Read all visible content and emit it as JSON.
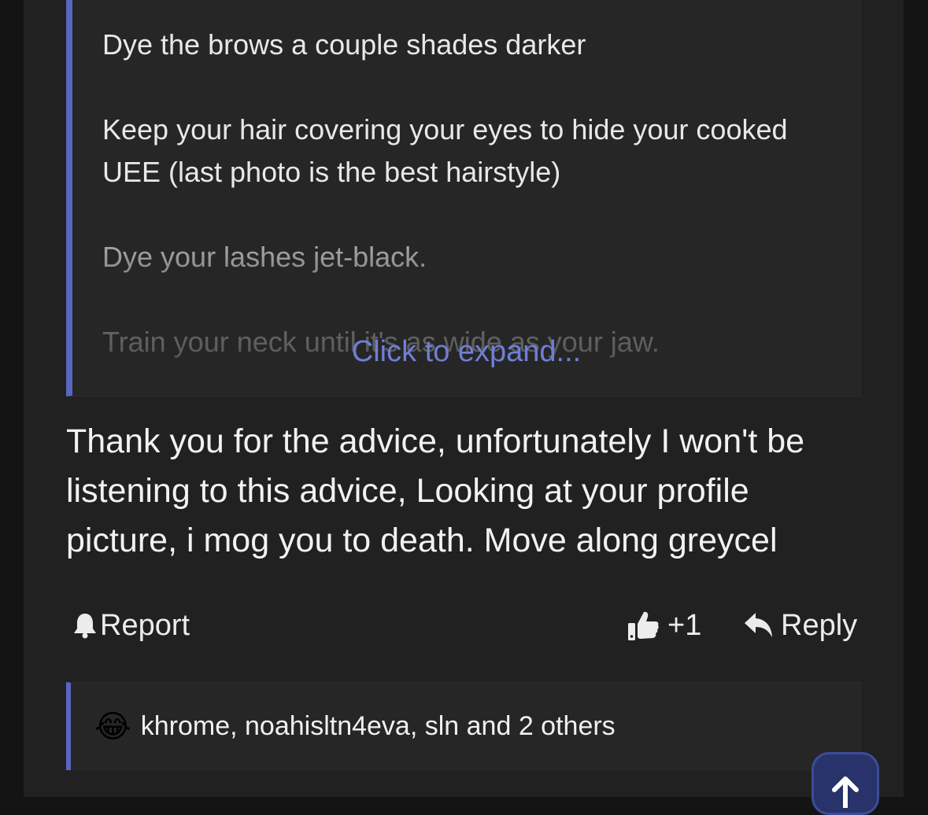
{
  "quote": {
    "paragraphs": [
      "Dye the brows a couple shades darker",
      "Keep your hair covering your eyes to hide your cooked UEE (last photo is the best hairstyle)",
      "Dye your lashes jet-black.",
      "Train your neck until it's as wide as your jaw."
    ],
    "expand_label": "Click to expand..."
  },
  "post": {
    "body": "Thank you for the advice, unfortunately I won't be listening to this advice, Looking at your profile picture, i mog you to death. Move along greycel"
  },
  "actions": {
    "report_label": "Report",
    "like_count": "+1",
    "reply_label": "Reply"
  },
  "reactions": {
    "text": "khrome, noahisltn4eva, sln and 2 others",
    "emoji": "😂"
  },
  "icons": {
    "report": "bell-icon",
    "like": "thumbs-up-icon",
    "reply": "reply-arrow-icon",
    "scroll_top": "arrow-up-icon"
  },
  "colors": {
    "accent": "#5b66c2",
    "link": "#6f7fd6",
    "background": "#212121",
    "quote_background": "#262626",
    "text": "#f2f2f2"
  }
}
